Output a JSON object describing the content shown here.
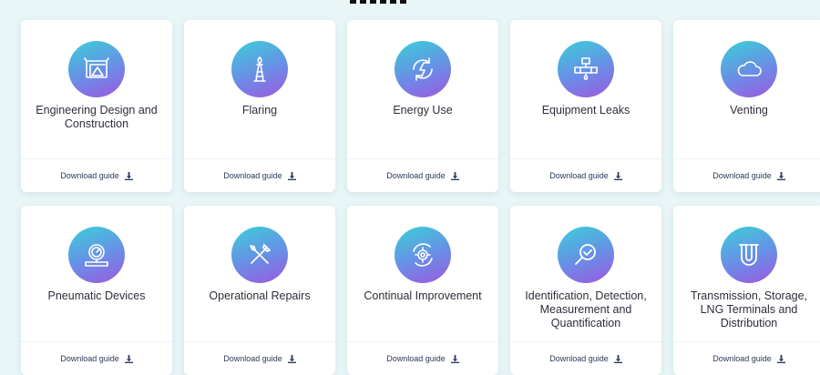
{
  "cards": [
    {
      "title": "Engineering Design and Construction",
      "icon": "blueprint-icon",
      "download_label": "Download guide"
    },
    {
      "title": "Flaring",
      "icon": "flare-tower-icon",
      "download_label": "Download guide"
    },
    {
      "title": "Energy Use",
      "icon": "energy-cycle-icon",
      "download_label": "Download guide"
    },
    {
      "title": "Equipment Leaks",
      "icon": "pipe-leak-icon",
      "download_label": "Download guide"
    },
    {
      "title": "Venting",
      "icon": "cloud-icon",
      "download_label": "Download guide"
    },
    {
      "title": "Pneumatic Devices",
      "icon": "pressure-gauge-icon",
      "download_label": "Download guide"
    },
    {
      "title": "Operational Repairs",
      "icon": "tools-icon",
      "download_label": "Download guide"
    },
    {
      "title": "Continual Improvement",
      "icon": "gear-cycle-icon",
      "download_label": "Download guide"
    },
    {
      "title": "Identification, Detection, Measurement and Quantification",
      "icon": "magnifier-check-icon",
      "download_label": "Download guide"
    },
    {
      "title": "Transmission, Storage, LNG Terminals and Distribution",
      "icon": "pipeline-icon",
      "download_label": "Download guide"
    }
  ]
}
